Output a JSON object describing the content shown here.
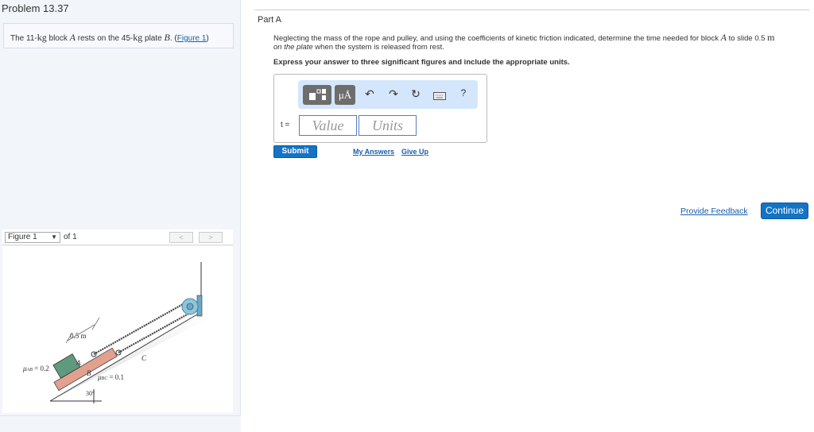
{
  "problem": {
    "title": "Problem 13.37",
    "intro_pre": "The 11-",
    "intro_kg1": "kg",
    "intro_mid1": " block ",
    "intro_A": "A",
    "intro_mid2": " rests on the 45-",
    "intro_kg2": "kg",
    "intro_mid3": " plate ",
    "intro_B": "B",
    "intro_end": ". (",
    "figure_link": "Figure 1",
    "intro_close": ")"
  },
  "figure": {
    "select": "Figure 1",
    "of": "of 1",
    "prev": "<",
    "next": ">",
    "labels": {
      "dist": "0.5 m",
      "A": "A",
      "B": "B",
      "C": "C",
      "muAB": "μ",
      "muAB_sub": "AB",
      "muAB_val": " = 0.2",
      "muBC": "μ",
      "muBC_sub": "BC",
      "muBC_val": " = 0.1",
      "angle": "30°"
    }
  },
  "part": {
    "title": "Part A",
    "q1": "Neglecting the mass of the rope and pulley, and using the coefficients of kinetic friction indicated, determine the time needed for block ",
    "qA": "A",
    "q2": " to slide 0.5 ",
    "qm": "m",
    "q3": "on the plate",
    "q4": " when the system is released from rest.",
    "instr": "Express your answer to three significant figures and include the appropriate units.",
    "toolbar": {
      "units": "μÅ",
      "help": "?"
    },
    "var": "t =",
    "value_ph": "Value",
    "units_ph": "Units",
    "submit": "Submit",
    "my_answers": "My Answers",
    "give_up": "Give Up"
  },
  "footer": {
    "feedback": "Provide Feedback",
    "continue": "Continue"
  }
}
